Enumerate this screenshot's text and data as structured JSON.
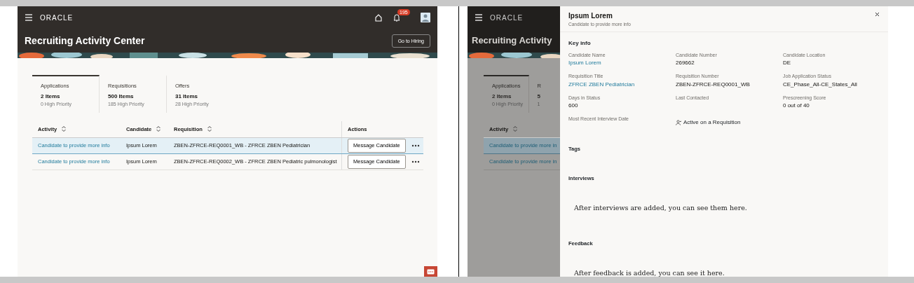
{
  "left_screen": {
    "header": {
      "logo": "ORACLE",
      "notification_count": "195"
    },
    "title": "Recruiting Activity Center",
    "hiring_button": "Go to Hiring",
    "tabs": [
      {
        "label": "Applications",
        "count": "2 Items",
        "priority": "0 High Priority",
        "selected": true
      },
      {
        "label": "Requisitions",
        "count": "500 Items",
        "priority": "185 High Priority",
        "selected": false
      },
      {
        "label": "Offers",
        "count": "31 Items",
        "priority": "28 High Priority",
        "selected": false
      }
    ],
    "table": {
      "columns": [
        {
          "label": "Activity",
          "sortable": true
        },
        {
          "label": "Candidate",
          "sortable": true
        },
        {
          "label": "Requisition",
          "sortable": true
        },
        {
          "label": "Actions"
        }
      ],
      "rows": [
        {
          "activity": "Candidate to provide more info",
          "candidate": "Ipsum Lorem",
          "requisition": "ZBEN-ZFRCE-REQ0001_WB - ZFRCE ZBEN Pediatrician",
          "action": "Message Candidate",
          "selected": true
        },
        {
          "activity": "Candidate to provide more info",
          "candidate": "Ipsum Lorem",
          "requisition": "ZBEN-ZFRCE-REQ0002_WB - ZFRCE ZBEN Pediatric pulmonologist",
          "action": "Message Candidate",
          "selected": false
        }
      ]
    }
  },
  "right_screen": {
    "background": {
      "logo": "ORACLE",
      "title": "Recruiting Activity",
      "tabs": [
        {
          "label": "Applications",
          "count": "2 Items",
          "priority": "0 High Priority",
          "selected": true
        },
        {
          "label": "R",
          "count": "5",
          "priority": "1",
          "selected": false
        }
      ],
      "column": "Activity",
      "rows": [
        {
          "activity": "Candidate to provide more in",
          "selected": true
        },
        {
          "activity": "Candidate to provide more in",
          "selected": false
        }
      ]
    },
    "drawer": {
      "title": "Ipsum Lorem",
      "subtitle": "Candidate to provide more info",
      "key_info_heading": "Key info",
      "fields": [
        {
          "kind": "field",
          "label": "Candidate Name",
          "value": "Ipsum Lorem",
          "link": true
        },
        {
          "kind": "field",
          "label": "Candidate Number",
          "value": "269662",
          "link": false
        },
        {
          "kind": "field",
          "label": "Candidate Location",
          "value": "DE",
          "link": false
        },
        {
          "kind": "field",
          "label": "Requisition Title",
          "value": "ZFRCE ZBEN Pediatrician",
          "link": true
        },
        {
          "kind": "field",
          "label": "Requisition Number",
          "value": "ZBEN-ZFRCE-REQ0001_WB",
          "link": false
        },
        {
          "kind": "field",
          "label": "Job Application Status",
          "value": "CE_Phase_All-CE_States_All",
          "link": false
        },
        {
          "kind": "field",
          "label": "Days in Status",
          "value": "600",
          "link": false
        },
        {
          "kind": "field",
          "label": "Last Contacted"
        },
        {
          "kind": "field",
          "label": "Prescreening Score",
          "value": "0 out of 40",
          "link": false
        },
        {
          "kind": "field",
          "label": "Most Recent Interview Date"
        },
        {
          "kind": "status",
          "text": "Active on a Requisition"
        }
      ],
      "sections": [
        {
          "heading": "Tags"
        },
        {
          "heading": "Interviews",
          "message": "After interviews are added, you can see them here."
        },
        {
          "heading": "Feedback",
          "message": "After feedback is added, you can see it here."
        }
      ]
    }
  }
}
